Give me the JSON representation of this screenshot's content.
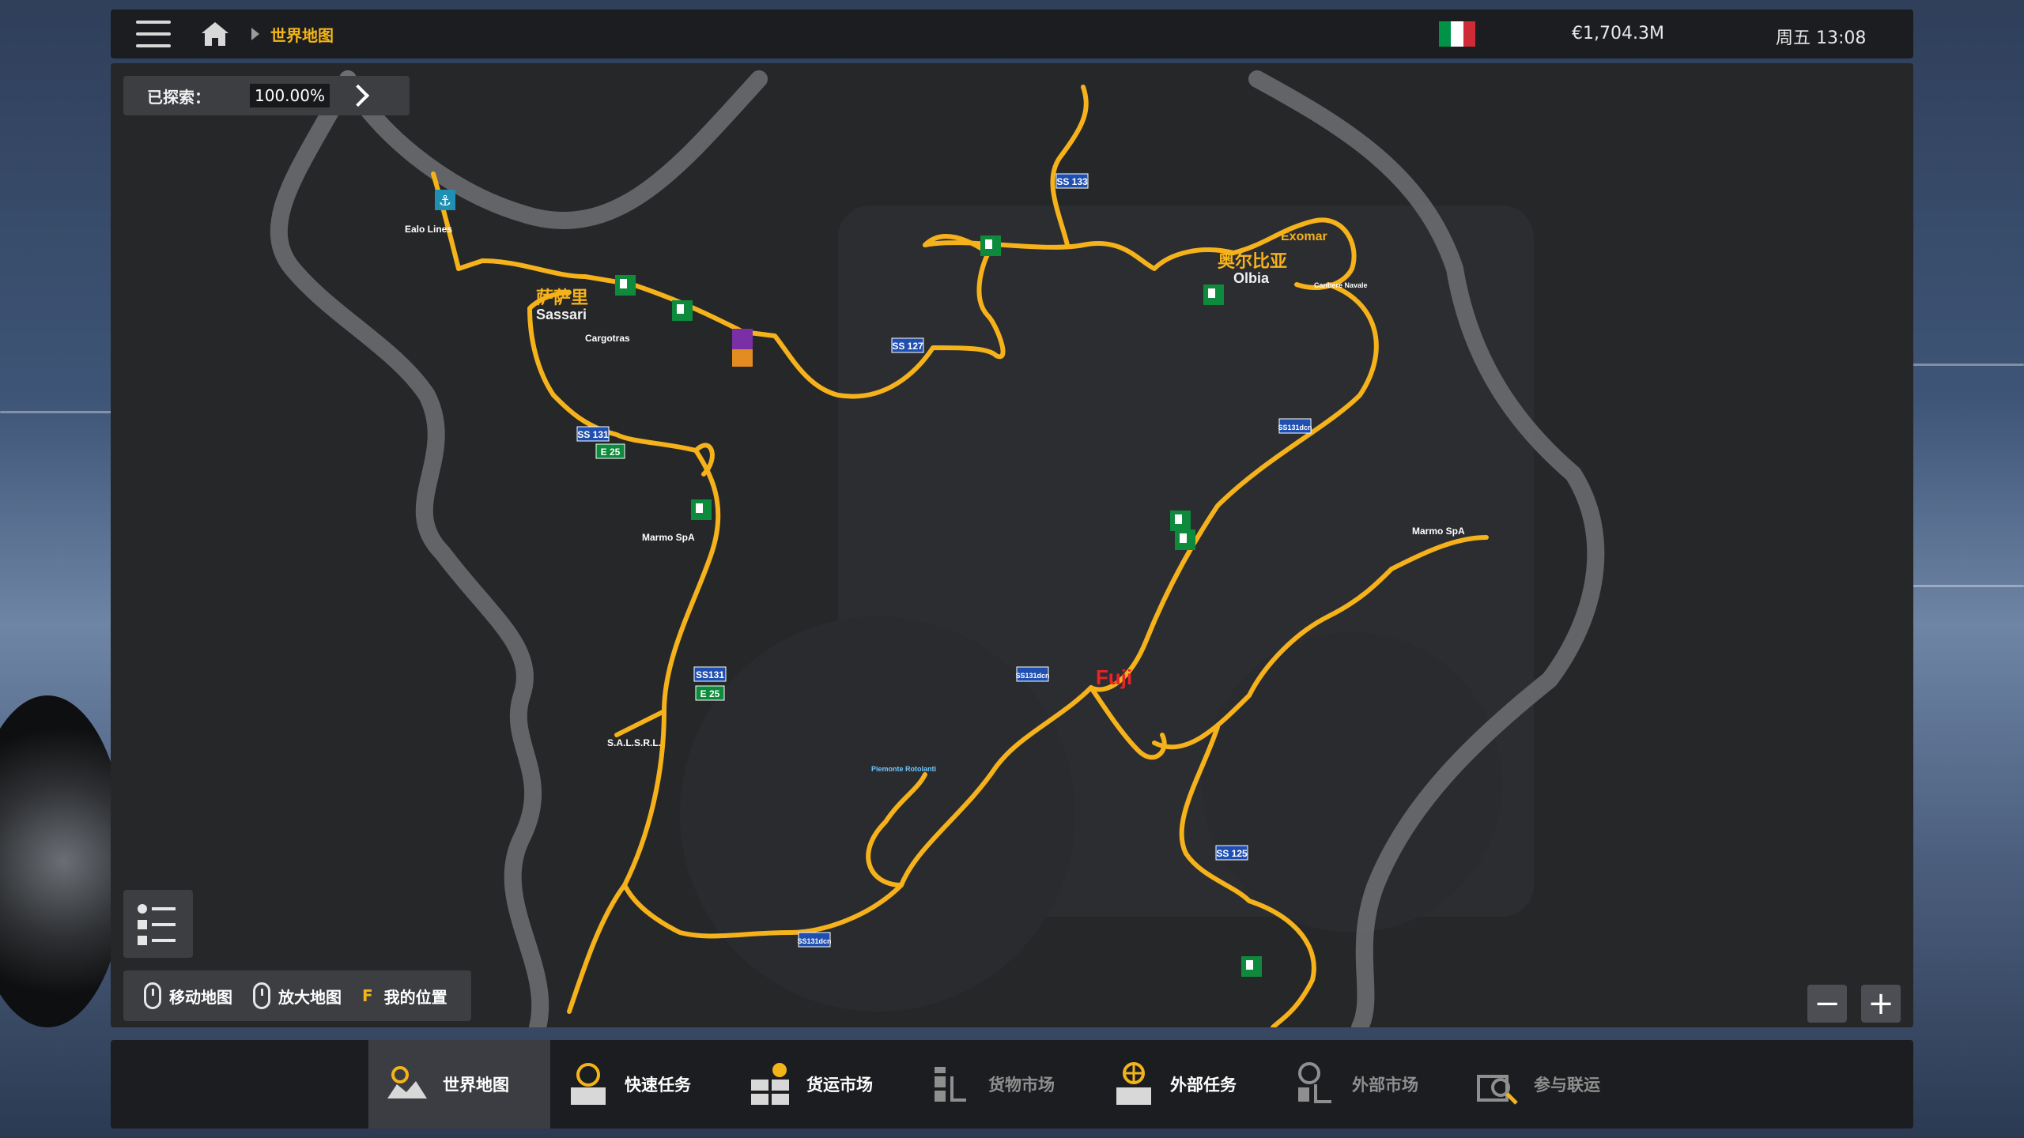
{
  "header": {
    "breadcrumb": "世界地图",
    "money": "€1,704.3M",
    "clock": "周五 13:08",
    "flag_colors": [
      "#009246",
      "#ffffff",
      "#ce2b37"
    ]
  },
  "map": {
    "explored_label": "已探索：",
    "explored_value": "100.00%",
    "cities": [
      {
        "name": "萨萨里",
        "sub": "Sassari"
      },
      {
        "name": "奥尔比亚",
        "sub": "Olbia"
      }
    ],
    "road_labels": [
      "SS 133",
      "SS 127",
      "SS 131",
      "E 25",
      "SS131",
      "E 25",
      "SS131dcn",
      "SS131dcn",
      "SS131dcn",
      "SS 125"
    ],
    "company_labels": [
      "Ealo Lines",
      "Cargotras",
      "Marmo SpA",
      "Marmo SpA",
      "Exomar",
      "S.A.L.S.R.L.",
      "Fuji",
      "Cantiere Navale",
      "Piemonte Rotolanti"
    ],
    "road_color": "#f5b21b",
    "controls": {
      "move": "移动地图",
      "zoom": "放大地图",
      "locate_key": "F",
      "locate": "我的位置"
    },
    "zoom_out": "−",
    "zoom_in": "+"
  },
  "nav": {
    "tabs": [
      {
        "label": "世界地图",
        "icon": "world-map-icon",
        "active": true
      },
      {
        "label": "快速任务",
        "icon": "quick-job-icon"
      },
      {
        "label": "货运市场",
        "icon": "freight-market-icon"
      },
      {
        "label": "货物市场",
        "icon": "cargo-market-icon"
      },
      {
        "label": "外部任务",
        "icon": "external-jobs-icon"
      },
      {
        "label": "外部市场",
        "icon": "external-market-icon"
      },
      {
        "label": "参与联运",
        "icon": "convoy-icon"
      }
    ]
  }
}
